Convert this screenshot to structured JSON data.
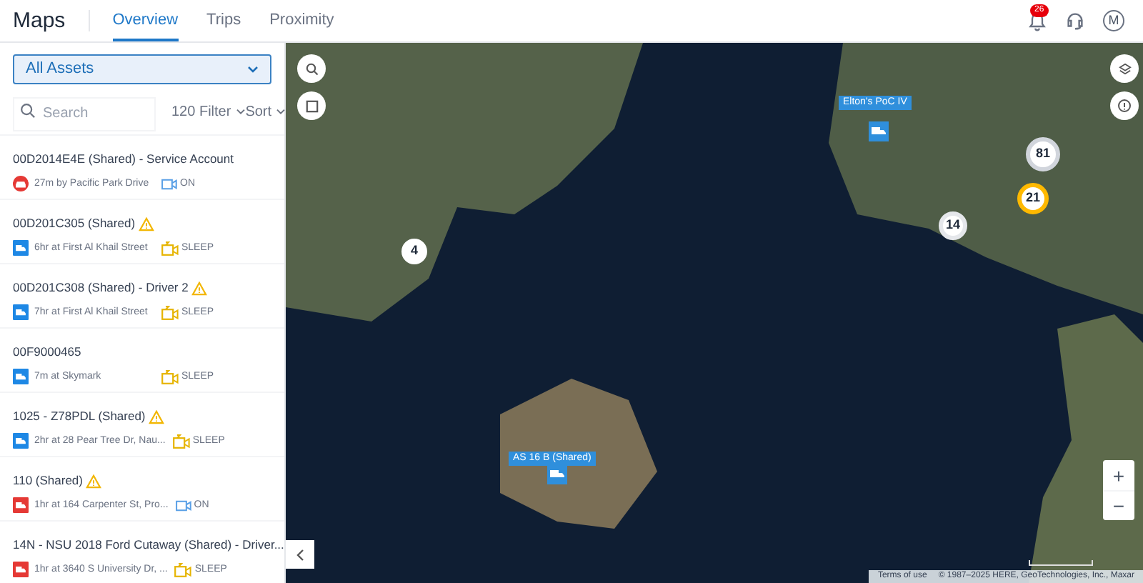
{
  "header": {
    "app_title": "Maps",
    "tabs": [
      {
        "label": "Overview",
        "selected": true
      },
      {
        "label": "Trips",
        "selected": false
      },
      {
        "label": "Proximity",
        "selected": false
      }
    ],
    "notification_count": "26",
    "avatar": "M"
  },
  "sidebar": {
    "asset_filter": "All Assets",
    "search": {
      "placeholder": "Search"
    },
    "filter": "120 Filter",
    "sort": "Sort",
    "assets": [
      {
        "name": "00D2014E4E (Shared) - Service Account",
        "warning": false,
        "kind": "car",
        "color": "#e53935",
        "location": "27m by Pacific Park Drive",
        "status": {
          "kind": "camera",
          "label": "ON"
        }
      },
      {
        "name": "00D201C305 (Shared)",
        "warning": true,
        "kind": "truck",
        "color": "#1e88e5",
        "location": "6hr at First Al Khail Street",
        "status": {
          "kind": "sleep",
          "label": "SLEEP"
        }
      },
      {
        "name": "00D201C308 (Shared) - Driver 2",
        "warning": true,
        "kind": "truck",
        "color": "#1e88e5",
        "location": "7hr at First Al Khail Street",
        "status": {
          "kind": "sleep",
          "label": "SLEEP"
        }
      },
      {
        "name": "00F9000465",
        "warning": false,
        "kind": "truck",
        "color": "#1e88e5",
        "location": "7m at Skymark",
        "status": {
          "kind": "sleep",
          "label": "SLEEP"
        }
      },
      {
        "name": "1025 - Z78PDL (Shared)",
        "warning": true,
        "kind": "truck",
        "color": "#1e88e5",
        "location": "2hr at 28 Pear Tree Dr, Nau...",
        "status": {
          "kind": "sleep",
          "label": "SLEEP"
        }
      },
      {
        "name": "110 (Shared)",
        "warning": true,
        "kind": "truck",
        "color": "#e53935",
        "location": "1hr at 164 Carpenter St, Pro...",
        "status": {
          "kind": "camera",
          "label": "ON"
        }
      },
      {
        "name": "14N - NSU 2018 Ford Cutaway (Shared) - Driver...",
        "warning": false,
        "kind": "truck",
        "color": "#e53935",
        "location": "1hr at 3640 S University Dr, ...",
        "status": {
          "kind": "sleep",
          "label": "SLEEP"
        }
      }
    ]
  },
  "map": {
    "clusters": [
      {
        "count": "81"
      },
      {
        "count": "21"
      },
      {
        "count": "14"
      },
      {
        "count": "4"
      }
    ],
    "vehicle_markers": [
      {
        "label": "Elton's PoC IV"
      },
      {
        "label": "AS 16 B (Shared)"
      }
    ],
    "zoom_in": "+",
    "zoom_out": "−",
    "terms": "Terms of use",
    "attribution": "© 1987–2025 HERE, GeoTechnologies, Inc., Maxar"
  }
}
